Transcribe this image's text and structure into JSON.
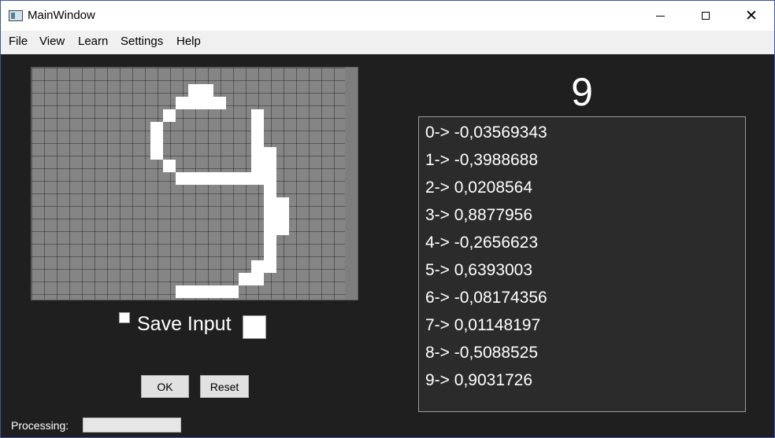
{
  "window": {
    "title": "MainWindow"
  },
  "titlebar_buttons": {
    "minimize": "minimize-icon",
    "maximize": "maximize-icon",
    "close": "close-icon"
  },
  "menu": [
    "File",
    "View",
    "Learn",
    "Settings",
    "Help"
  ],
  "grid": {
    "columns": 26,
    "rows": 18,
    "cell_color": "#858585",
    "ink_color": "#ffffff",
    "filled_cells": [
      [
        12,
        1
      ],
      [
        13,
        1
      ],
      [
        11,
        2
      ],
      [
        12,
        2
      ],
      [
        13,
        2
      ],
      [
        14,
        2
      ],
      [
        10,
        3
      ],
      [
        17,
        3
      ],
      [
        9,
        4
      ],
      [
        17,
        4
      ],
      [
        9,
        5
      ],
      [
        17,
        5
      ],
      [
        9,
        6
      ],
      [
        17,
        6
      ],
      [
        18,
        6
      ],
      [
        10,
        7
      ],
      [
        17,
        7
      ],
      [
        18,
        7
      ],
      [
        11,
        8
      ],
      [
        12,
        8
      ],
      [
        13,
        8
      ],
      [
        14,
        8
      ],
      [
        15,
        8
      ],
      [
        16,
        8
      ],
      [
        17,
        8
      ],
      [
        18,
        8
      ],
      [
        18,
        9
      ],
      [
        18,
        10
      ],
      [
        19,
        10
      ],
      [
        18,
        11
      ],
      [
        19,
        11
      ],
      [
        18,
        12
      ],
      [
        19,
        12
      ],
      [
        18,
        13
      ],
      [
        18,
        14
      ],
      [
        17,
        15
      ],
      [
        18,
        15
      ],
      [
        16,
        16
      ],
      [
        17,
        16
      ],
      [
        15,
        17
      ],
      [
        11,
        18
      ],
      [
        12,
        18
      ],
      [
        13,
        18
      ],
      [
        14,
        18
      ],
      [
        15,
        18
      ]
    ]
  },
  "save_input": {
    "label": "Save Input",
    "checked": false
  },
  "buttons": {
    "ok": "OK",
    "reset": "Reset"
  },
  "processing": {
    "label": "Processing:",
    "progress": 0
  },
  "prediction": "9",
  "outputs": [
    "0-> -0,03569343",
    "1-> -0,3988688",
    "2-> 0,0208564",
    "3-> 0,8877956",
    "4-> -0,2656623",
    "5-> 0,6393003",
    "6-> -0,08174356",
    "7-> 0,01148197",
    "8-> -0,5088525",
    "9-> 0,9031726"
  ]
}
